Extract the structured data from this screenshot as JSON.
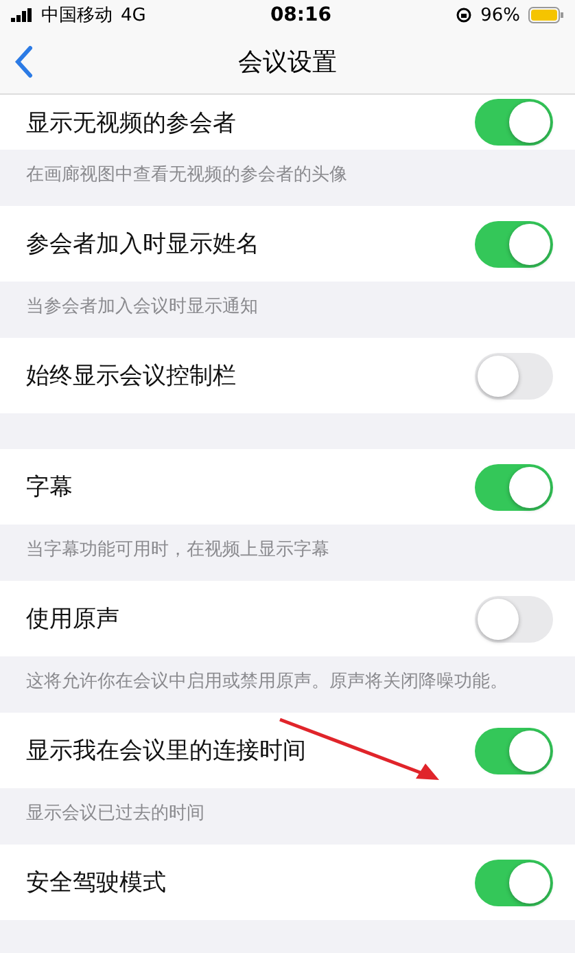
{
  "status_bar": {
    "carrier": "中国移动",
    "network": "4G",
    "time": "08:16",
    "battery": "96%"
  },
  "nav": {
    "title": "会议设置"
  },
  "rows": [
    {
      "label": "显示无视频的参会者",
      "on": true,
      "note": "在画廊视图中查看无视频的参会者的头像"
    },
    {
      "label": "参会者加入时显示姓名",
      "on": true,
      "note": "当参会者加入会议时显示通知"
    },
    {
      "label": "始终显示会议控制栏",
      "on": false
    },
    {
      "label": "字幕",
      "on": true,
      "note": "当字幕功能可用时，在视频上显示字幕"
    },
    {
      "label": "使用原声",
      "on": false,
      "note": "这将允许你在会议中启用或禁用原声。原声将关闭降噪功能。"
    },
    {
      "label": "显示我在会议里的连接时间",
      "on": true,
      "note": "显示会议已过去的时间"
    },
    {
      "label": "安全驾驶模式",
      "on": true
    }
  ]
}
